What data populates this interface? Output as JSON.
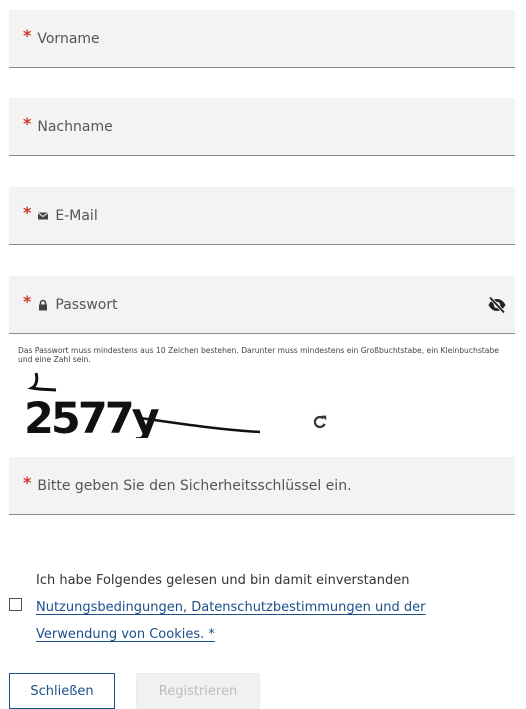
{
  "fields": {
    "firstname": {
      "required_mark": "*",
      "placeholder": "Vorname"
    },
    "lastname": {
      "required_mark": "*",
      "placeholder": "Nachname"
    },
    "email": {
      "required_mark": "*",
      "placeholder": "E-Mail",
      "icon": "envelope-icon"
    },
    "password": {
      "required_mark": "*",
      "placeholder": "Passwort",
      "icon": "lock-icon",
      "toggle_icon": "eye-slash-icon"
    },
    "captcha_input": {
      "required_mark": "*",
      "placeholder": "Bitte geben Sie den Sicherheitsschlüssel ein."
    }
  },
  "password_hint": "Das Passwort muss mindestens aus 10 Zeichen bestehen. Darunter muss mindestens ein Großbuchtstabe, ein Kleinbuchstabe und eine Zahl sein.",
  "captcha": {
    "text": "2577y",
    "refresh_icon": "refresh-icon"
  },
  "consent": {
    "text": "Ich habe Folgendes gelesen und bin damit einverstanden",
    "link": "Nutzungsbedingungen, Datenschutzbestimmungen und der Verwendung von Cookies. *",
    "checked": false
  },
  "buttons": {
    "close": "Schließen",
    "register": "Registrieren"
  },
  "colors": {
    "required": "#d0382c",
    "link": "#1b4f8a",
    "field_bg": "#f3f3f3",
    "disabled_text": "#bdbdbd"
  }
}
